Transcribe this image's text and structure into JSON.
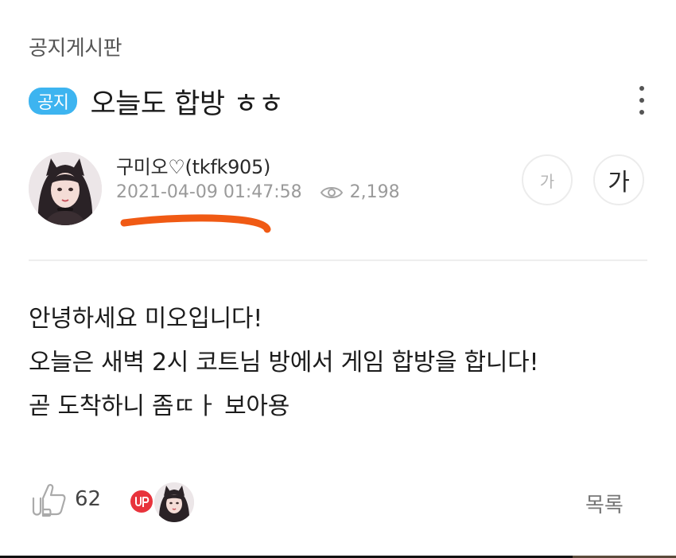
{
  "board": {
    "name": "공지게시판"
  },
  "post": {
    "badge": "공지",
    "title": "오늘도 합방 ㅎㅎ",
    "author": "구미오♡(tkfk905)",
    "datetime": "2021-04-09 01:47:58",
    "views": "2,198",
    "body": [
      "안녕하세요 미오입니다!",
      "오늘은 새벽 2시 코트님 방에서 게임 합방을 합니다!",
      "곧 도착하니 좀ㄸㅏ 보아용"
    ]
  },
  "font_controls": {
    "smaller_label": "가",
    "larger_label": "가"
  },
  "footer": {
    "up_label": "UP",
    "up_count": "62",
    "liker_badge_label": "UP",
    "list_label": "목록"
  },
  "colors": {
    "badge": "#3db4f0",
    "highlight_stroke": "#f05a14",
    "up_badge": "#e8333c"
  }
}
